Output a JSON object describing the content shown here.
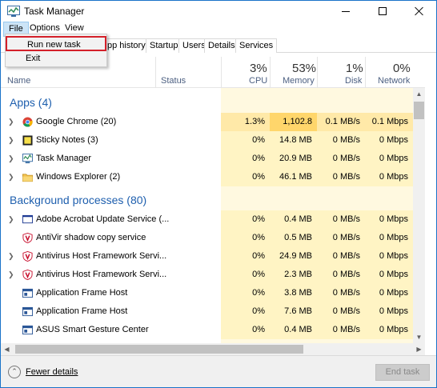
{
  "window": {
    "title": "Task Manager"
  },
  "menu": {
    "file": "File",
    "options": "Options",
    "view": "View"
  },
  "file_menu": {
    "run_new_task": "Run new task",
    "exit": "Exit"
  },
  "tabs": [
    "pp history",
    "Startup",
    "Users",
    "Details",
    "Services"
  ],
  "columns": {
    "name": "Name",
    "status": "Status",
    "cpu": {
      "percent": "3%",
      "label": "CPU"
    },
    "memory": {
      "percent": "53%",
      "label": "Memory"
    },
    "disk": {
      "percent": "1%",
      "label": "Disk"
    },
    "network": {
      "percent": "0%",
      "label": "Network"
    }
  },
  "sections": {
    "apps": "Apps (4)",
    "background": "Background processes (80)"
  },
  "apps": [
    {
      "name": "Google Chrome (20)",
      "cpu": "1.3%",
      "memory": "1,102.8 MB",
      "disk": "0.1 MB/s",
      "network": "0.1 Mbps",
      "icon": "chrome-icon"
    },
    {
      "name": "Sticky Notes (3)",
      "cpu": "0%",
      "memory": "14.8 MB",
      "disk": "0 MB/s",
      "network": "0 Mbps",
      "icon": "sticky-notes-icon"
    },
    {
      "name": "Task Manager",
      "cpu": "0%",
      "memory": "20.9 MB",
      "disk": "0 MB/s",
      "network": "0 Mbps",
      "icon": "task-manager-icon"
    },
    {
      "name": "Windows Explorer (2)",
      "cpu": "0%",
      "memory": "46.1 MB",
      "disk": "0 MB/s",
      "network": "0 Mbps",
      "icon": "explorer-icon"
    }
  ],
  "background": [
    {
      "name": "Adobe Acrobat Update Service (...",
      "cpu": "0%",
      "memory": "0.4 MB",
      "disk": "0 MB/s",
      "network": "0 Mbps",
      "icon": "acrobat-update-icon"
    },
    {
      "name": "AntiVir shadow copy service",
      "cpu": "0%",
      "memory": "0.5 MB",
      "disk": "0 MB/s",
      "network": "0 Mbps",
      "icon": "antivir-icon"
    },
    {
      "name": "Antivirus Host Framework Servi...",
      "cpu": "0%",
      "memory": "24.9 MB",
      "disk": "0 MB/s",
      "network": "0 Mbps",
      "icon": "antivirus-host-icon"
    },
    {
      "name": "Antivirus Host Framework Servi...",
      "cpu": "0%",
      "memory": "2.3 MB",
      "disk": "0 MB/s",
      "network": "0 Mbps",
      "icon": "antivirus-host-icon"
    },
    {
      "name": "Application Frame Host",
      "cpu": "0%",
      "memory": "3.8 MB",
      "disk": "0 MB/s",
      "network": "0 Mbps",
      "icon": "app-frame-host-icon"
    },
    {
      "name": "Application Frame Host",
      "cpu": "0%",
      "memory": "7.6 MB",
      "disk": "0 MB/s",
      "network": "0 Mbps",
      "icon": "app-frame-host-icon"
    },
    {
      "name": "ASUS Smart Gesture Center",
      "cpu": "0%",
      "memory": "0.4 MB",
      "disk": "0 MB/s",
      "network": "0 Mbps",
      "icon": "asus-gesture-icon"
    }
  ],
  "footer": {
    "fewer_details": "Fewer details",
    "end_task": "End task"
  },
  "colors": {
    "accent": "#1e5fae",
    "heat_low": "#fff4c4",
    "heat_mid": "#ffe9a8",
    "highlight_border": "#d4202a"
  }
}
